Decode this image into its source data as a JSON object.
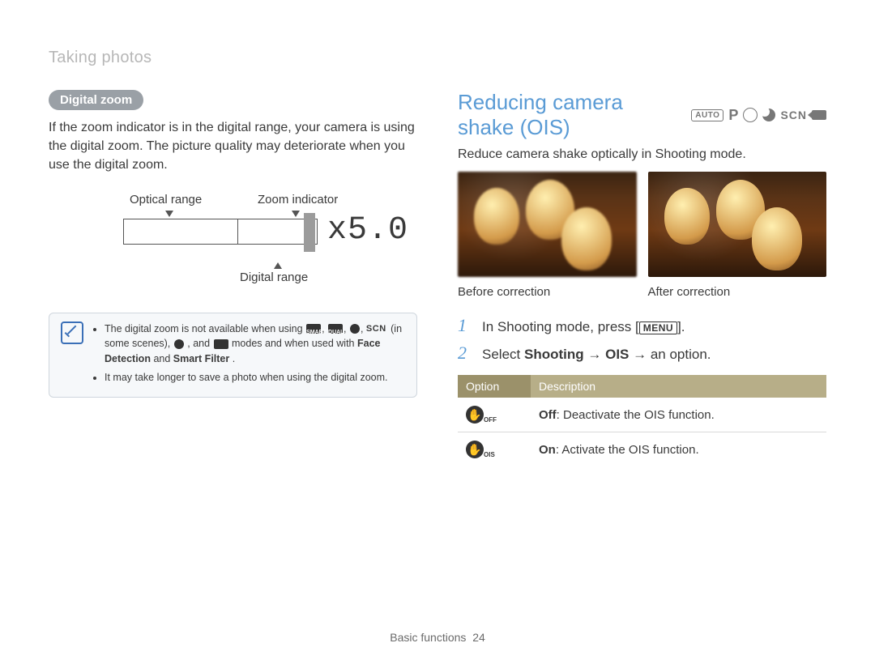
{
  "breadcrumb": "Taking photos",
  "left": {
    "badge": "Digital zoom",
    "body": "If the zoom indicator is in the digital range, your camera is using the digital zoom. The picture quality may deteriorate when you use the digital zoom.",
    "diagram": {
      "optical_label": "Optical range",
      "zoom_indicator_label": "Zoom indicator",
      "digital_label": "Digital range",
      "zoom_readout": "x5.0"
    },
    "note": {
      "bullet1_prefix": "The digital zoom is not available when using ",
      "bullet1_smart_sub": "SMART",
      "bullet1_dual_sub": "DUAL",
      "bullet1_mid": " (in some scenes), ",
      "bullet1_mid2": ", and ",
      "bullet1_suffix": " modes and when used with ",
      "bullet1_fd": "Face Detection",
      "bullet1_and": " and ",
      "bullet1_sf": "Smart Filter",
      "bullet1_period": ".",
      "scn_inline": "SCN",
      "bullet2": "It may take longer to save a photo when using the digital zoom."
    }
  },
  "right": {
    "title": "Reducing camera shake (OIS)",
    "modes": {
      "auto": "AUTO",
      "p": "P",
      "scn": "SCN"
    },
    "subtitle": "Reduce camera shake optically in Shooting mode.",
    "before_caption": "Before correction",
    "after_caption": "After correction",
    "steps": {
      "s1": "In Shooting mode, press [",
      "s1_menu": "MENU",
      "s1_end": "].",
      "s2_pre": "Select ",
      "s2_shooting": "Shooting",
      "s2_arrow": " → ",
      "s2_ois": "OIS",
      "s2_end": " → an option."
    },
    "table": {
      "h_option": "Option",
      "h_desc": "Description",
      "row1_sub": "OFF",
      "row1_label": "Off",
      "row1_desc": ": Deactivate the OIS function.",
      "row2_sub": "OIS",
      "row2_label": "On",
      "row2_desc": ": Activate the OIS function."
    }
  },
  "footer": {
    "section": "Basic functions",
    "page": "24"
  }
}
